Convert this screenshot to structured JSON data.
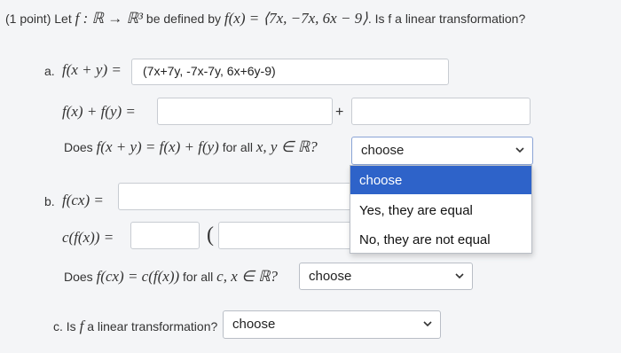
{
  "header": {
    "points": "(1 point)",
    "let_text": "Let",
    "fmap": "f : ℝ → ℝ³",
    "be_defined": "be defined by",
    "formula": "f(x) = ⟨7x, −7x, 6x − 9⟩",
    "question": ". Is f a linear transformation?"
  },
  "part_a": {
    "label": "a.",
    "fxy": "f(x + y) =",
    "fxy_value": "(7x+7y, -7x-7y, 6x+6y-9)",
    "fx_plus_fy": "f(x) + f(y) =",
    "plus": "+",
    "question_prefix": "Does",
    "question_math": "f(x + y) = f(x) + f(y)",
    "question_mid": "for all",
    "question_vars": "x, y ∈ ℝ?",
    "select_value": "choose",
    "dropdown_options": [
      "choose",
      "Yes, they are equal",
      "No, they are not equal"
    ],
    "dropdown_selected_index": 0
  },
  "part_b": {
    "label": "b.",
    "fcx": "f(cx) =",
    "cfx": "c(f(x)) =",
    "paren": "(",
    "question_prefix": "Does",
    "question_math": "f(cx) = c(f(x))",
    "question_mid": "for all",
    "question_vars": "c, x ∈ ℝ?",
    "select_value": "choose"
  },
  "part_c": {
    "label": "c. Is",
    "f_symbol": "f",
    "question_rest": "a linear transformation?",
    "select_value": "choose"
  },
  "colors": {
    "highlight": "#2e63c9",
    "background": "#f4f5f7"
  }
}
